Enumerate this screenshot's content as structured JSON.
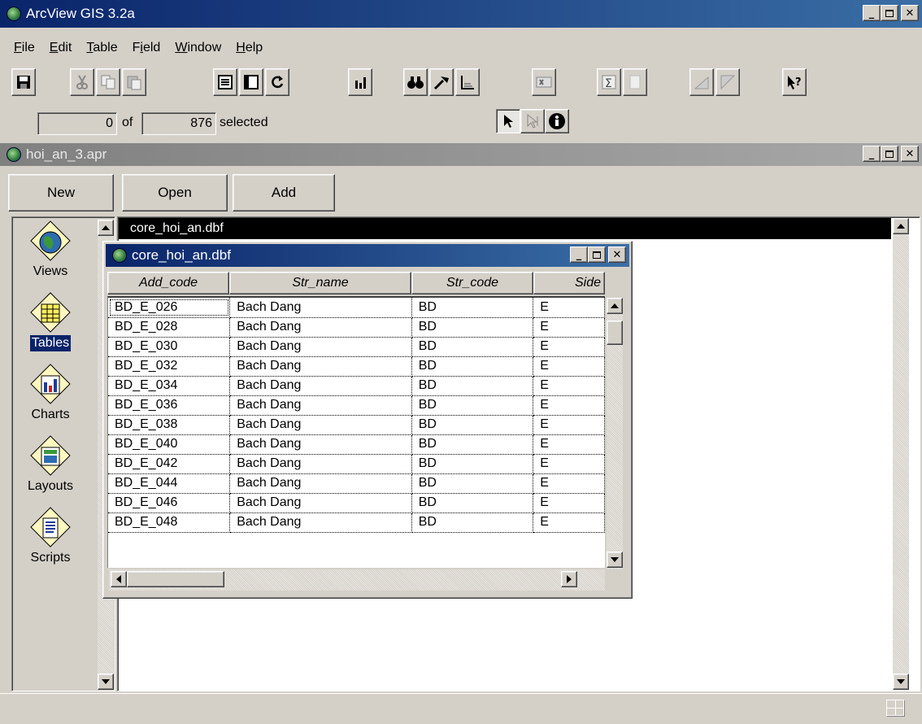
{
  "app": {
    "title": "ArcView GIS 3.2a",
    "menu": [
      {
        "label": "File",
        "mnemonic": "F",
        "rest": "ile"
      },
      {
        "label": "Edit",
        "mnemonic": "E",
        "rest": "dit"
      },
      {
        "label": "Table",
        "mnemonic": "T",
        "rest": "able"
      },
      {
        "label": "Field",
        "mnemonic": "i",
        "pre": "F",
        "rest": "eld"
      },
      {
        "label": "Window",
        "mnemonic": "W",
        "rest": "indow"
      },
      {
        "label": "Help",
        "mnemonic": "H",
        "rest": "elp"
      }
    ],
    "toolbar_icons": [
      "save-icon",
      "cut-icon",
      "copy-icon",
      "paste-icon",
      "properties-icon",
      "promote-icon",
      "refresh-icon",
      "chart-icon",
      "find-icon",
      "query-icon",
      "sort-icon",
      "summarize-icon",
      "calculate-icon",
      "join-icon",
      "remove-join-icon",
      "sort-ascending-icon",
      "sort-descending-icon",
      "help-icon"
    ],
    "selection": {
      "selected_count": "0",
      "of_label": "of",
      "total_count": "876",
      "suffix": "selected"
    },
    "tools": [
      "select-arrow-icon",
      "edit-cursor-icon",
      "identify-icon"
    ]
  },
  "project": {
    "title": "hoi_an_3.apr",
    "buttons": {
      "new": "New",
      "open": "Open",
      "add": "Add"
    },
    "doc_types": [
      {
        "label": "Views",
        "icon": "globe-icon",
        "selected": false
      },
      {
        "label": "Tables",
        "icon": "table-icon",
        "selected": true
      },
      {
        "label": "Charts",
        "icon": "chart-icon",
        "selected": false
      },
      {
        "label": "Layouts",
        "icon": "layout-icon",
        "selected": false
      },
      {
        "label": "Scripts",
        "icon": "script-icon",
        "selected": false
      }
    ],
    "documents": [
      "core_hoi_an.dbf"
    ]
  },
  "table_window": {
    "title": "core_hoi_an.dbf",
    "columns": [
      "Add_code",
      "Str_name",
      "Str_code",
      "Side"
    ],
    "rows": [
      [
        "BD_E_026",
        "Bach Dang",
        "BD",
        "E"
      ],
      [
        "BD_E_028",
        "Bach Dang",
        "BD",
        "E"
      ],
      [
        "BD_E_030",
        "Bach Dang",
        "BD",
        "E"
      ],
      [
        "BD_E_032",
        "Bach Dang",
        "BD",
        "E"
      ],
      [
        "BD_E_034",
        "Bach Dang",
        "BD",
        "E"
      ],
      [
        "BD_E_036",
        "Bach Dang",
        "BD",
        "E"
      ],
      [
        "BD_E_038",
        "Bach Dang",
        "BD",
        "E"
      ],
      [
        "BD_E_040",
        "Bach Dang",
        "BD",
        "E"
      ],
      [
        "BD_E_042",
        "Bach Dang",
        "BD",
        "E"
      ],
      [
        "BD_E_044",
        "Bach Dang",
        "BD",
        "E"
      ],
      [
        "BD_E_046",
        "Bach Dang",
        "BD",
        "E"
      ],
      [
        "BD_E_048",
        "Bach Dang",
        "BD",
        "E"
      ]
    ]
  },
  "colors": {
    "active_title": "#0a246a",
    "inactive_title": "#808080",
    "face": "#d4d0c8",
    "selection": "#0a246a"
  }
}
